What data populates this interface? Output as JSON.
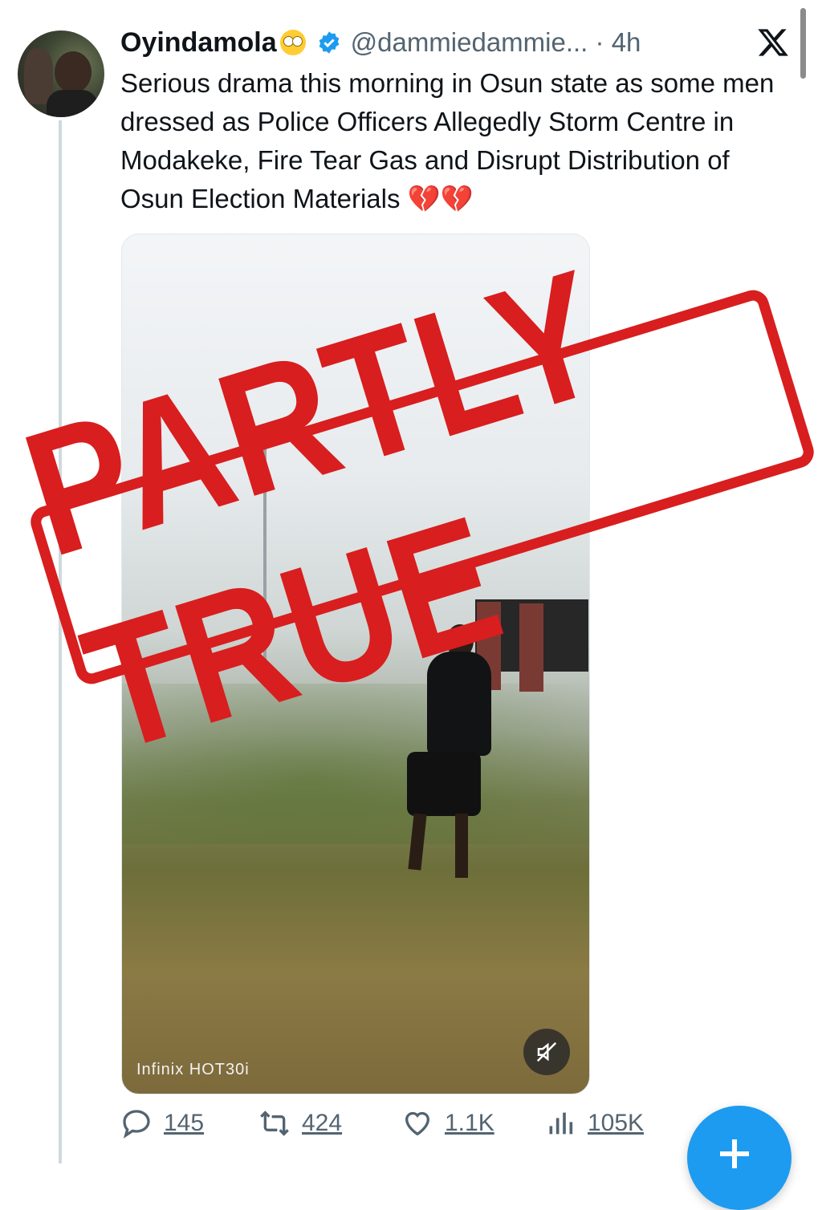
{
  "tweet": {
    "display_name": "Oyindamola",
    "emoji": "🙄",
    "handle": "@dammiedammie...",
    "separator": "·",
    "time": "4h",
    "text": "Serious drama this morning in Osun state as some men dressed as Police Officers Allegedly Storm Centre in Modakeke, Fire Tear Gas and Disrupt Distribution of Osun Election Materials 💔💔"
  },
  "media": {
    "watermark": "Infinix HOT30i",
    "mute_icon": "speaker-muted-icon"
  },
  "stamp": {
    "text": "PARTLY TRUE",
    "color": "#d81e1e"
  },
  "actions": {
    "replies": "145",
    "reposts": "424",
    "likes": "1.1K",
    "views": "105K"
  },
  "colors": {
    "accent": "#1d9bf0",
    "secondary_text": "#536471"
  },
  "icons": [
    "verified-badge-icon",
    "x-logo-icon",
    "reply-icon",
    "repost-icon",
    "like-icon",
    "views-icon",
    "compose-plus-icon"
  ]
}
